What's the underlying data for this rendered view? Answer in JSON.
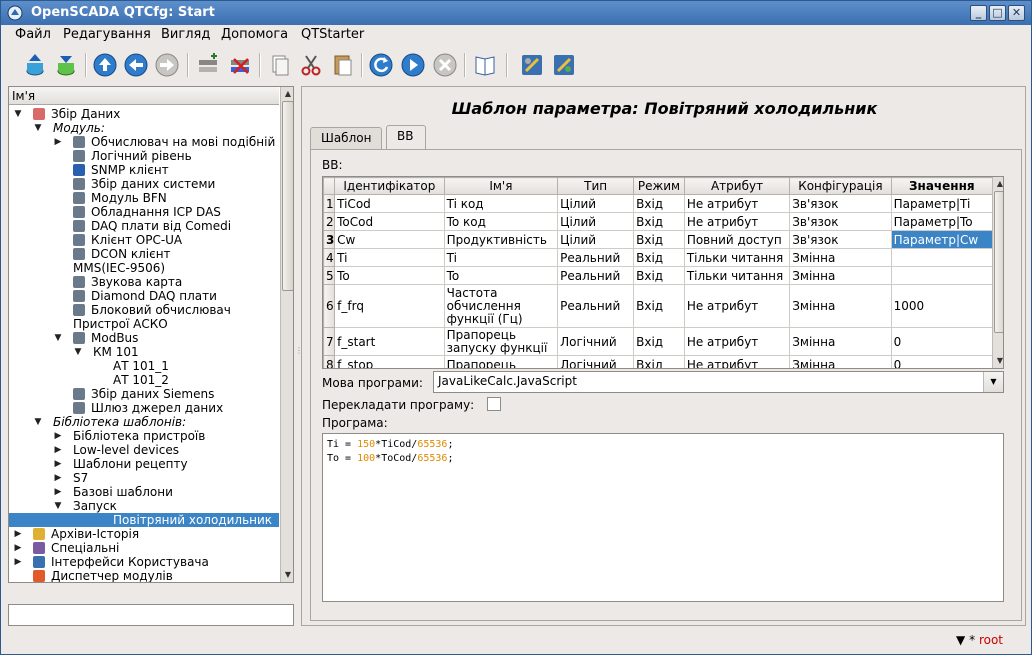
{
  "window": {
    "title": "OpenSCADA QTCfg: Start"
  },
  "menu": [
    "Файл",
    "Редагування",
    "Вигляд",
    "Допомога",
    "QTStarter"
  ],
  "toolbar_icons": [
    "db-load-icon",
    "db-save-icon",
    "up-icon",
    "back-icon",
    "forward-icon",
    "add-item-icon",
    "delete-item-icon",
    "copy-icon",
    "cut-icon",
    "paste-icon",
    "refresh-icon",
    "start-icon",
    "stop-icon",
    "manual-icon",
    "config-icon",
    "config2-icon"
  ],
  "tree": {
    "header": "Ім'я",
    "items": [
      {
        "label": "Збір Даних",
        "level": 1,
        "arrow": "down",
        "icon": "chart-icon"
      },
      {
        "label": "Модуль:",
        "level": 2,
        "arrow": "down",
        "italic": true
      },
      {
        "label": "Обчислювач на мові подібній",
        "level": 3,
        "arrow": "right",
        "icon": "module-icon"
      },
      {
        "label": "Логічний рівень",
        "level": 3,
        "icon": "module-icon"
      },
      {
        "label": "SNMP клієнт",
        "level": 3,
        "icon": "snmp-icon"
      },
      {
        "label": "Збір даних системи",
        "level": 3,
        "icon": "module-icon"
      },
      {
        "label": "Модуль BFN",
        "level": 3,
        "icon": "module-icon"
      },
      {
        "label": "Обладнання ICP DAS",
        "level": 3,
        "icon": "module-icon"
      },
      {
        "label": "DAQ плати від Comedi",
        "level": 3,
        "icon": "module-icon"
      },
      {
        "label": "Клієнт OPC-UA",
        "level": 3,
        "icon": "module-icon"
      },
      {
        "label": "DCON клієнт",
        "level": 3,
        "icon": "module-icon"
      },
      {
        "label": "MMS(IEC-9506)",
        "level": 3
      },
      {
        "label": "Звукова карта",
        "level": 3,
        "icon": "module-icon"
      },
      {
        "label": "Diamond DAQ плати",
        "level": 3,
        "icon": "module-icon"
      },
      {
        "label": "Блоковий обчислювач",
        "level": 3,
        "icon": "module-icon"
      },
      {
        "label": "Пристрої АСКО",
        "level": 3
      },
      {
        "label": "ModBus",
        "level": 3,
        "arrow": "down",
        "icon": "module-icon"
      },
      {
        "label": "КМ 101",
        "level": 4,
        "arrow": "down"
      },
      {
        "label": "АТ 101_1",
        "level": 5
      },
      {
        "label": "АТ 101_2",
        "level": 5
      },
      {
        "label": "Збір даних Siemens",
        "level": 3,
        "icon": "module-icon"
      },
      {
        "label": "Шлюз джерел даних",
        "level": 3,
        "icon": "module-icon"
      },
      {
        "label": "Бібліотека шаблонів:",
        "level": 2,
        "arrow": "down",
        "italic": true
      },
      {
        "label": "Бібліотека пристроїв",
        "level": 3,
        "arrow": "right"
      },
      {
        "label": "Low-level devices",
        "level": 3,
        "arrow": "right"
      },
      {
        "label": "Шаблони рецепту",
        "level": 3,
        "arrow": "right"
      },
      {
        "label": "S7",
        "level": 3,
        "arrow": "right"
      },
      {
        "label": "Базові шаблони",
        "level": 3,
        "arrow": "right"
      },
      {
        "label": "Запуск",
        "level": 3,
        "arrow": "down"
      },
      {
        "label": "Повітряний холодильник",
        "level": 5,
        "selected": true
      },
      {
        "label": "Архіви-Історія",
        "level": 1,
        "arrow": "right",
        "icon": "archive-icon"
      },
      {
        "label": "Спеціальні",
        "level": 1,
        "arrow": "right",
        "icon": "special-icon"
      },
      {
        "label": "Інтерфейси Користувача",
        "level": 1,
        "arrow": "right",
        "icon": "ui-icon"
      },
      {
        "label": "Диспетчер модулів",
        "level": 1,
        "icon": "modules-icon"
      }
    ]
  },
  "page": {
    "title": "Шаблон параметра: Повітряний холодильник",
    "tabs": [
      "Шаблон",
      "ВВ"
    ],
    "io_label": "ВВ:",
    "table": {
      "columns": [
        "",
        "Ідентифікатор",
        "Ім'я",
        "Тип",
        "Режим",
        "Атрибут",
        "Конфігурація",
        "Значення"
      ],
      "rows": [
        [
          "1",
          "TiCod",
          "Ti код",
          "Цілий",
          "Вхід",
          "Не атрибут",
          "Зв'язок",
          "Параметр|Ti"
        ],
        [
          "2",
          "ToCod",
          "To код",
          "Цілий",
          "Вхід",
          "Не атрибут",
          "Зв'язок",
          "Параметр|To"
        ],
        [
          "3",
          "Cw",
          "Продуктивність",
          "Цілий",
          "Вхід",
          "Повний доступ",
          "Зв'язок",
          "Параметр|Cw"
        ],
        [
          "4",
          "Ti",
          "Ti",
          "Реальний",
          "Вхід",
          "Тільки читання",
          "Змінна",
          ""
        ],
        [
          "5",
          "To",
          "To",
          "Реальний",
          "Вхід",
          "Тільки читання",
          "Змінна",
          ""
        ],
        [
          "6",
          "f_frq",
          "Частота обчислення функції (Гц)",
          "Реальний",
          "Вхід",
          "Не атрибут",
          "Змінна",
          "1000"
        ],
        [
          "7",
          "f_start",
          "Прапорець запуску функції",
          "Логічний",
          "Вхід",
          "Не атрибут",
          "Змінна",
          "0"
        ],
        [
          "8",
          "f_stop",
          "Прапорець",
          "Логічний",
          "Вхід",
          "Не атрибут",
          "Змінна",
          "0"
        ]
      ]
    },
    "lang_label": "Мова програми:",
    "lang_value": "JavaLikeCalc.JavaScript",
    "translate_label": "Перекладати програму:",
    "translate_checked": false,
    "program_label": "Програма:",
    "program_lines": [
      {
        "pre": "Ti = ",
        "n1": "150",
        "mid": "*TiCod/",
        "n2": "65536",
        "post": ";"
      },
      {
        "pre": "To = ",
        "n1": "100",
        "mid": "*ToCod/",
        "n2": "65536",
        "post": ";"
      }
    ]
  },
  "status": {
    "modified": "*",
    "user": "root"
  }
}
